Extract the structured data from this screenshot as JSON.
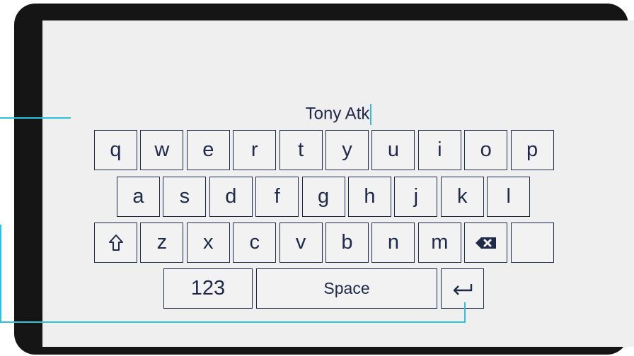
{
  "text_field": {
    "value": "Tony Atk"
  },
  "keyboard": {
    "row1": [
      "q",
      "w",
      "e",
      "r",
      "t",
      "y",
      "u",
      "i",
      "o",
      "p"
    ],
    "row2": [
      "a",
      "s",
      "d",
      "f",
      "g",
      "h",
      "j",
      "k",
      "l"
    ],
    "row3": [
      "z",
      "x",
      "c",
      "v",
      "b",
      "n",
      "m"
    ],
    "numbers_label": "123",
    "space_label": "Space",
    "shift_icon": "shift-arrow-icon",
    "backspace_icon": "backspace-icon",
    "enter_icon": "enter-arrow-icon"
  },
  "colors": {
    "bezel": "#151515",
    "screen": "#efefef",
    "key_border": "#1f2a4a",
    "key_text": "#1f2a4a",
    "accent": "#2fbfe0"
  }
}
